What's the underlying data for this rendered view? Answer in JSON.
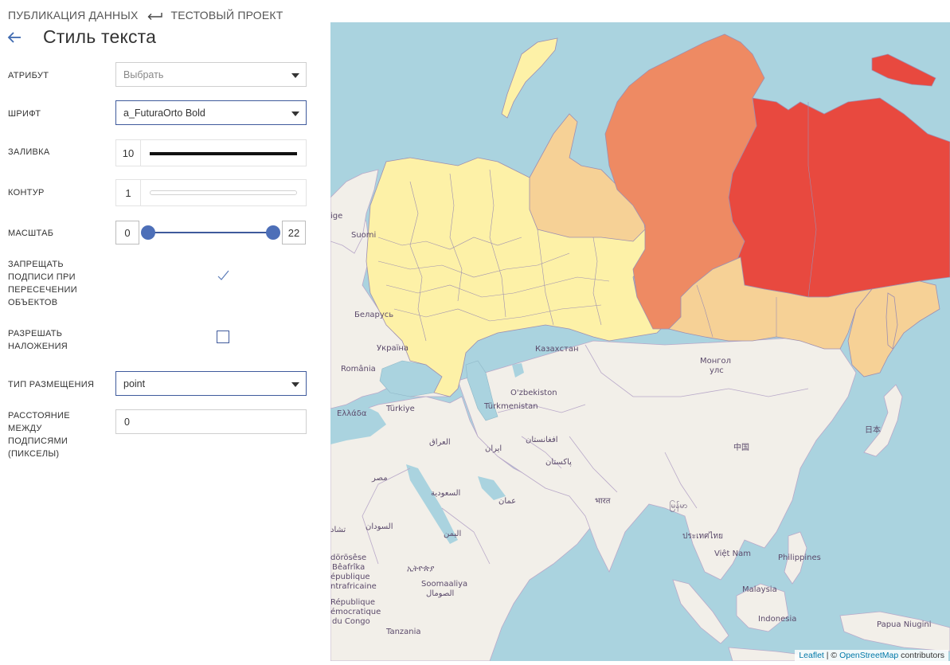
{
  "breadcrumb": {
    "parent": "ПУБЛИКАЦИЯ ДАННЫХ",
    "project": "ТЕСТОВЫЙ ПРОЕКТ"
  },
  "page": {
    "title": "Стиль текста"
  },
  "form": {
    "attribute": {
      "label": "АТРИБУТ",
      "placeholder": "Выбрать"
    },
    "font": {
      "label": "ШРИФТ",
      "value": "a_FuturaOrto Bold"
    },
    "fill": {
      "label": "ЗАЛИВКА",
      "size": "10",
      "color": "#111111"
    },
    "outline": {
      "label": "КОНТУР",
      "size": "1"
    },
    "scale": {
      "label": "МАСШТАБ",
      "min": "0",
      "max": "22"
    },
    "forbid_overlap": {
      "label_lines": [
        "ЗАПРЕЩАТЬ",
        "ПОДПИСИ ПРИ",
        "ПЕРЕСЕЧЕНИИ",
        "ОБЪЕКТОВ"
      ],
      "checked": true
    },
    "allow_overlay": {
      "label_lines": [
        "РАЗРЕШАТЬ",
        "НАЛОЖЕНИЯ"
      ],
      "checked": false
    },
    "placement": {
      "label": "ТИП РАЗМЕЩЕНИЯ",
      "value": "point"
    },
    "spacing": {
      "label_lines": [
        "РАССТОЯНИЕ",
        "МЕЖДУ",
        "ПОДПИСЯМИ",
        "(ПИКСЕЛЫ)"
      ],
      "value": "0"
    }
  },
  "map": {
    "labels": {
      "suomi": "Suomi",
      "belarus": "Беларусь",
      "ukraine": "Україна",
      "romania": "România",
      "kazakhstan": "Казахстан",
      "mongolia_1": "Монгол",
      "mongolia_2": "улс",
      "uzbekistan": "O'zbekiston",
      "turkmenistan": "Türkmenistan",
      "turkey": "Türkiye",
      "greece": "Ελλάδα",
      "iraq": "العراق",
      "iran": "ایران",
      "afghanistan": "افغانستان",
      "pakistan": "پاکستان",
      "china": "中国",
      "japan": "日本",
      "egypt": "مصر",
      "saudi": "السعودية",
      "oman": "عمان",
      "india": "भारत",
      "myanmar": "မြန်မာ",
      "sudan": "السودان",
      "chad": "تشاد",
      "yemen": "اليمن",
      "thailand": "ประเทศไทย",
      "vietnam": "Việt Nam",
      "philippines": "Philippines",
      "malaysia": "Malaysia",
      "indonesia": "Indonesia",
      "ethiopia": "ኢትዮጵያ",
      "somalia_1": "Soomaaliya",
      "somalia_2": "الصومال",
      "car_1": "dörösêse",
      "car_2": "Bêafrîka",
      "car_3": "épublique",
      "car_4": "ntrafricaine",
      "drc_1": "République",
      "drc_2": "émocratique",
      "drc_3": "du Congo",
      "tanzania": "Tanzania",
      "png": "Papua Niugini",
      "sverige": "ige"
    },
    "attribution": {
      "leaflet": "Leaflet",
      "sep": " | © ",
      "osm": "OpenStreetMap",
      "suffix": " contributors"
    },
    "colors": {
      "water": "#aad3df",
      "land": "#f2efe9",
      "russia_low": "#fdf1a7",
      "russia_mid": "#f6d196",
      "krasnoyarsk": "#ee8a63",
      "yakutia": "#e8493f",
      "border": "#9e8fb0"
    }
  }
}
